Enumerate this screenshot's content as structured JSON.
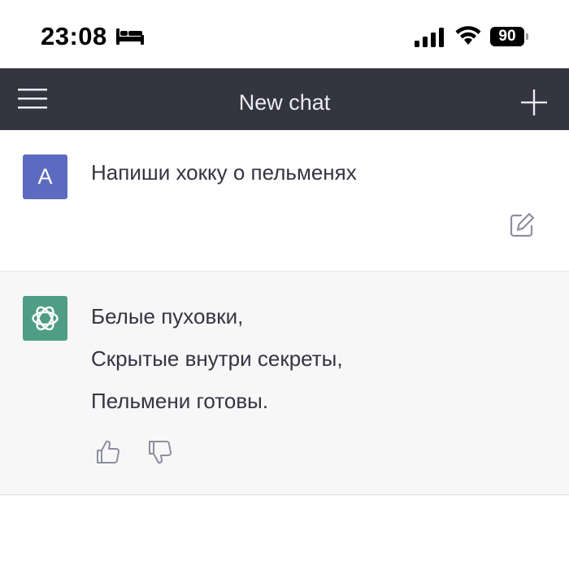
{
  "status_bar": {
    "time": "23:08",
    "battery_level": "90",
    "icons": [
      "bed-icon",
      "signal-icon",
      "wifi-icon",
      "battery-icon"
    ]
  },
  "nav": {
    "title": "New chat",
    "icons": [
      "menu-icon",
      "plus-icon"
    ]
  },
  "conversation": {
    "user_message": {
      "avatar_letter": "A",
      "text": "Напиши хокку о пельменях",
      "icons": [
        "edit-icon"
      ]
    },
    "assistant_message": {
      "avatar_icon": "openai-logo-icon",
      "lines": [
        "Белые пуховки,",
        "Скрытые внутри секреты,",
        "Пельмени готовы."
      ],
      "icons": [
        "thumbs-up-icon",
        "thumbs-down-icon"
      ]
    }
  },
  "colors": {
    "nav_background": "#343541",
    "user_avatar": "#5c6bc0",
    "assistant_avatar": "#4e9d84",
    "assistant_background": "#f7f7f8"
  }
}
